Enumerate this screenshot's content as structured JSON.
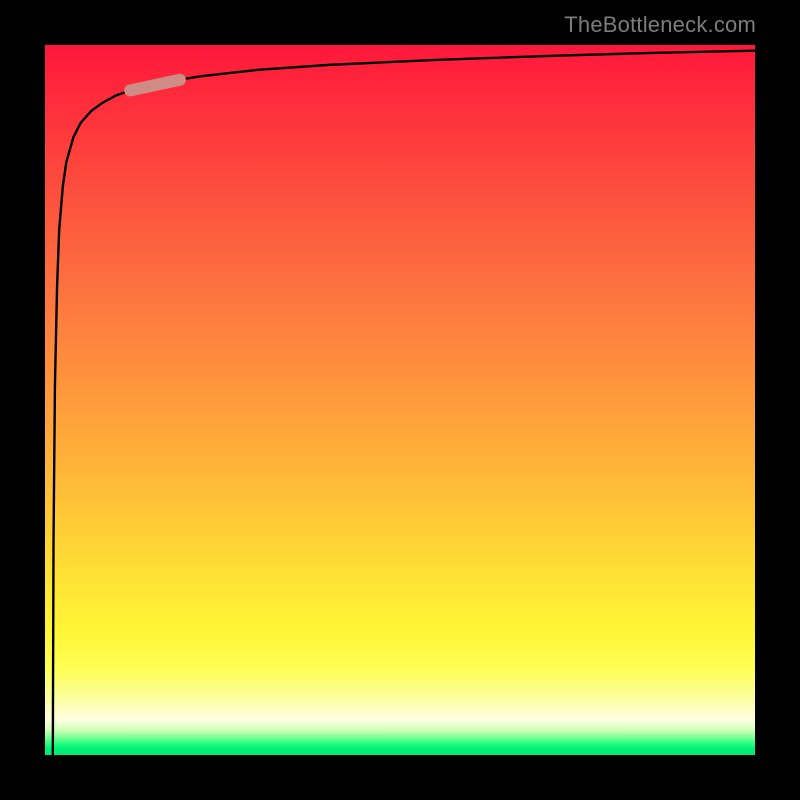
{
  "credit": "TheBottleneck.com",
  "colors": {
    "curve": "#000000",
    "marker_fill": "#cf8b85",
    "marker_stroke": "#b97871",
    "background": "#000000"
  },
  "chart_data": {
    "type": "line",
    "title": "",
    "xlabel": "",
    "ylabel": "",
    "xlim": [
      0,
      100
    ],
    "ylim": [
      0,
      100
    ],
    "gradient_stops": [
      {
        "pos": 0,
        "color": "#ff173b"
      },
      {
        "pos": 8,
        "color": "#ff2d3b"
      },
      {
        "pos": 20,
        "color": "#fd4d3d"
      },
      {
        "pos": 33,
        "color": "#fd6f3f"
      },
      {
        "pos": 45,
        "color": "#fe8e3c"
      },
      {
        "pos": 57,
        "color": "#ffae39"
      },
      {
        "pos": 67,
        "color": "#ffca35"
      },
      {
        "pos": 75,
        "color": "#ffe234"
      },
      {
        "pos": 82,
        "color": "#fff433"
      },
      {
        "pos": 88,
        "color": "#feff55"
      },
      {
        "pos": 92.5,
        "color": "#fbffa9"
      },
      {
        "pos": 95,
        "color": "#ffffe2"
      },
      {
        "pos": 96.5,
        "color": "#d1ffb8"
      },
      {
        "pos": 97.5,
        "color": "#7cff96"
      },
      {
        "pos": 98.3,
        "color": "#2dff82"
      },
      {
        "pos": 99,
        "color": "#00f477"
      },
      {
        "pos": 100,
        "color": "#00e874"
      }
    ],
    "series": [
      {
        "name": "curve",
        "x": [
          1.1,
          1.2,
          1.4,
          1.7,
          2.0,
          2.5,
          3.0,
          4.0,
          5.0,
          6.5,
          8.0,
          10.0,
          13.0,
          17.0,
          22.0,
          30.0,
          40.0,
          55.0,
          72.0,
          86.0,
          100.0
        ],
        "y": [
          0.0,
          30.0,
          52.0,
          66.0,
          74.0,
          80.0,
          83.5,
          87.0,
          89.0,
          90.7,
          91.8,
          92.9,
          93.9,
          94.8,
          95.6,
          96.5,
          97.2,
          97.9,
          98.5,
          98.9,
          99.2
        ]
      }
    ],
    "marker": {
      "x_start": 12.0,
      "y_start": 93.6,
      "x_end": 19.0,
      "y_end": 95.1
    }
  }
}
